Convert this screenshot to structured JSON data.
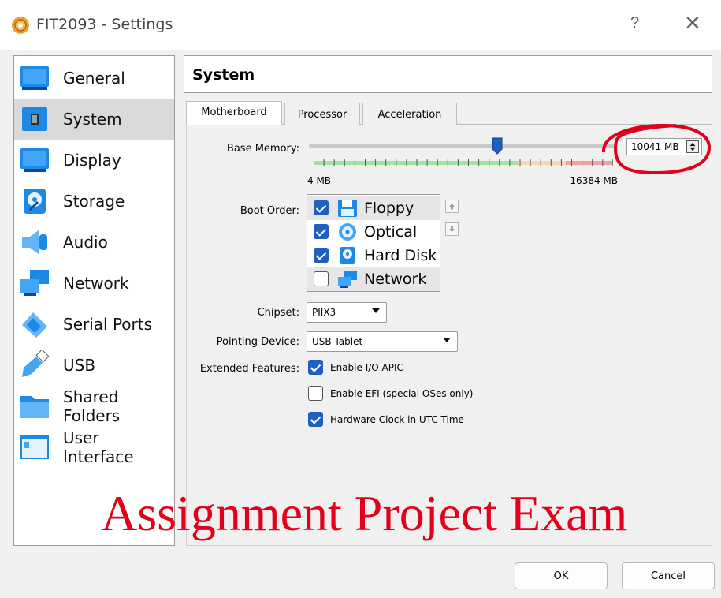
{
  "window": {
    "title": "FIT2093 - Settings",
    "help_label": "?",
    "close_label": "✕"
  },
  "sidebar": {
    "items": [
      {
        "label": "General",
        "icon": "general-icon"
      },
      {
        "label": "System",
        "icon": "system-icon",
        "selected": true
      },
      {
        "label": "Display",
        "icon": "display-icon"
      },
      {
        "label": "Storage",
        "icon": "storage-icon"
      },
      {
        "label": "Audio",
        "icon": "audio-icon"
      },
      {
        "label": "Network",
        "icon": "network-icon"
      },
      {
        "label": "Serial Ports",
        "icon": "serial-ports-icon"
      },
      {
        "label": "USB",
        "icon": "usb-icon"
      },
      {
        "label": "Shared Folders",
        "icon": "shared-folders-icon"
      },
      {
        "label": "User Interface",
        "icon": "user-interface-icon"
      }
    ]
  },
  "header": {
    "title": "System"
  },
  "tabs": [
    {
      "label": "Motherboard",
      "active": true
    },
    {
      "label": "Processor"
    },
    {
      "label": "Acceleration"
    }
  ],
  "motherboard": {
    "base_memory_label": "Base Memory:",
    "memory_value": "10041 MB",
    "memory_min": "4 MB",
    "memory_max": "16384 MB",
    "memory_fraction": 0.613,
    "boot_order_label": "Boot Order:",
    "boot_items": [
      {
        "label": "Floppy",
        "checked": true,
        "icon": "floppy-icon"
      },
      {
        "label": "Optical",
        "checked": true,
        "icon": "optical-icon"
      },
      {
        "label": "Hard Disk",
        "checked": true,
        "icon": "hard-disk-icon"
      },
      {
        "label": "Network",
        "checked": false,
        "icon": "network-icon"
      }
    ],
    "chipset_label": "Chipset:",
    "chipset_value": "PIIX3",
    "pointing_label": "Pointing Device:",
    "pointing_value": "USB Tablet",
    "extended_label": "Extended Features:",
    "features": [
      {
        "label": "Enable I/O APIC",
        "checked": true
      },
      {
        "label": "Enable EFI (special OSes only)",
        "checked": false
      },
      {
        "label": "Hardware Clock in UTC Time",
        "checked": true
      }
    ]
  },
  "watermark": "Assignment Project Exam",
  "buttons": {
    "ok": "OK",
    "cancel": "Cancel"
  },
  "colors": {
    "accent": "#1f5fbf",
    "annotation": "#e2001a",
    "selected_bg": "#d9d9d9"
  }
}
